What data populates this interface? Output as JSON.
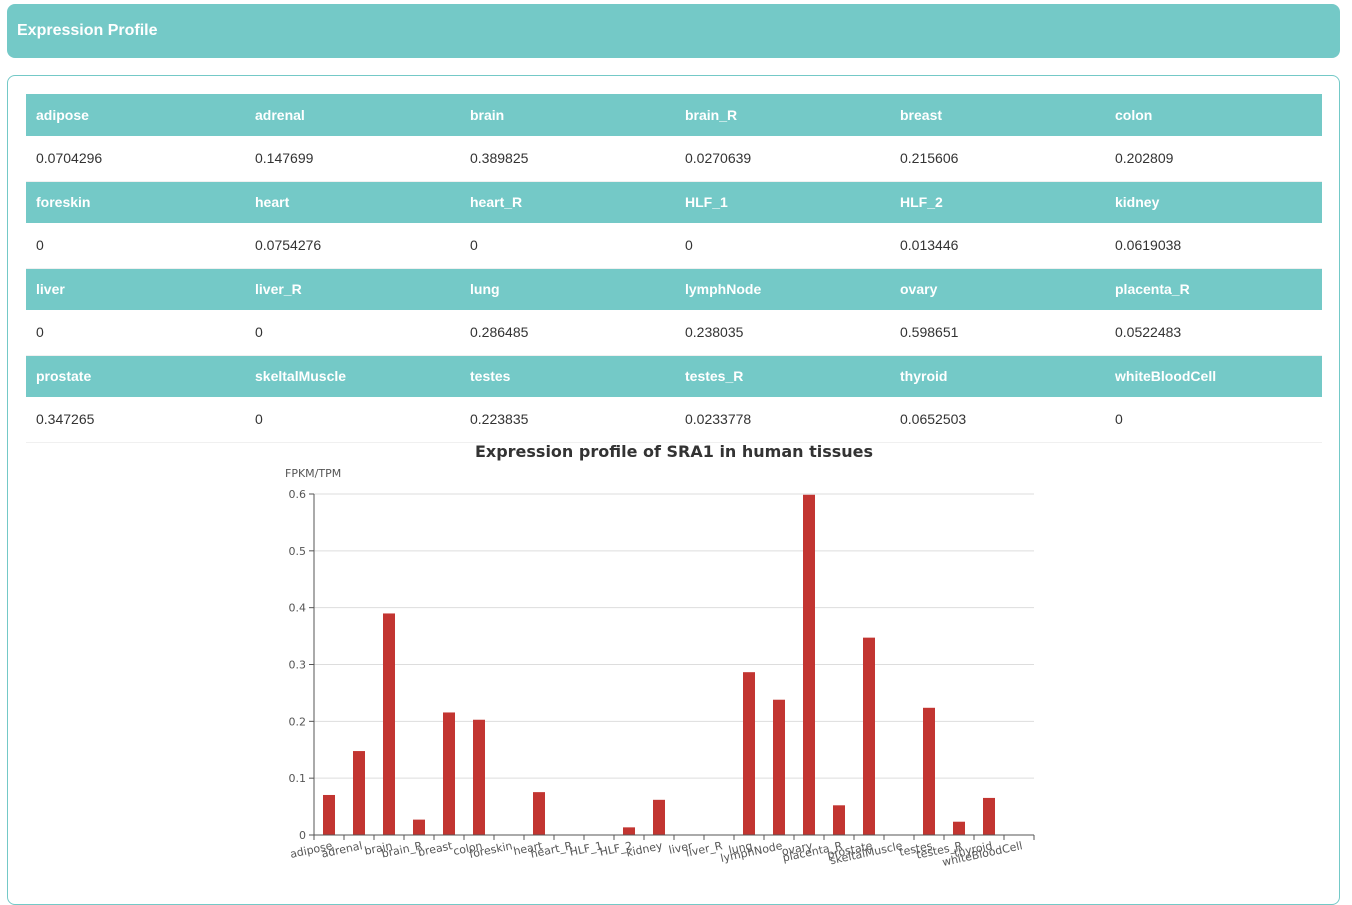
{
  "header": {
    "title": "Expression Profile"
  },
  "table": {
    "rows": [
      {
        "headers": [
          "adipose",
          "adrenal",
          "brain",
          "brain_R",
          "breast",
          "colon"
        ],
        "values": [
          "0.0704296",
          "0.147699",
          "0.389825",
          "0.0270639",
          "0.215606",
          "0.202809"
        ]
      },
      {
        "headers": [
          "foreskin",
          "heart",
          "heart_R",
          "HLF_1",
          "HLF_2",
          "kidney"
        ],
        "values": [
          "0",
          "0.0754276",
          "0",
          "0",
          "0.013446",
          "0.0619038"
        ]
      },
      {
        "headers": [
          "liver",
          "liver_R",
          "lung",
          "lymphNode",
          "ovary",
          "placenta_R"
        ],
        "values": [
          "0",
          "0",
          "0.286485",
          "0.238035",
          "0.598651",
          "0.0522483"
        ]
      },
      {
        "headers": [
          "prostate",
          "skeltalMuscle",
          "testes",
          "testes_R",
          "thyroid",
          "whiteBloodCell"
        ],
        "values": [
          "0.347265",
          "0",
          "0.223835",
          "0.0233778",
          "0.0652503",
          "0"
        ]
      }
    ]
  },
  "chart_data": {
    "type": "bar",
    "title": "Expression profile of SRA1 in human tissues",
    "xlabel": "",
    "ylabel": "FPKM/TPM",
    "ylim": [
      0,
      0.6
    ],
    "yticks": [
      "0",
      "0.1",
      "0.2",
      "0.3",
      "0.4",
      "0.5",
      "0.6"
    ],
    "grid": true,
    "bar_color": "#c23531",
    "categories": [
      "adipose",
      "adrenal",
      "brain",
      "brain_R",
      "breast",
      "colon",
      "foreskin",
      "heart",
      "heart_R",
      "HLF_1",
      "HLF_2",
      "kidney",
      "liver",
      "liver_R",
      "lung",
      "lymphNode",
      "ovary",
      "placenta_R",
      "prostate",
      "skeltalMuscle",
      "testes",
      "testes_R",
      "thyroid",
      "whiteBloodCell"
    ],
    "values": [
      0.0704296,
      0.147699,
      0.389825,
      0.0270639,
      0.215606,
      0.202809,
      0,
      0.0754276,
      0,
      0,
      0.013446,
      0.0619038,
      0,
      0,
      0.286485,
      0.238035,
      0.598651,
      0.0522483,
      0.347265,
      0,
      0.223835,
      0.0233778,
      0.0652503,
      0
    ]
  },
  "colors": {
    "accent": "#74c9c7",
    "bar": "#c23531"
  }
}
